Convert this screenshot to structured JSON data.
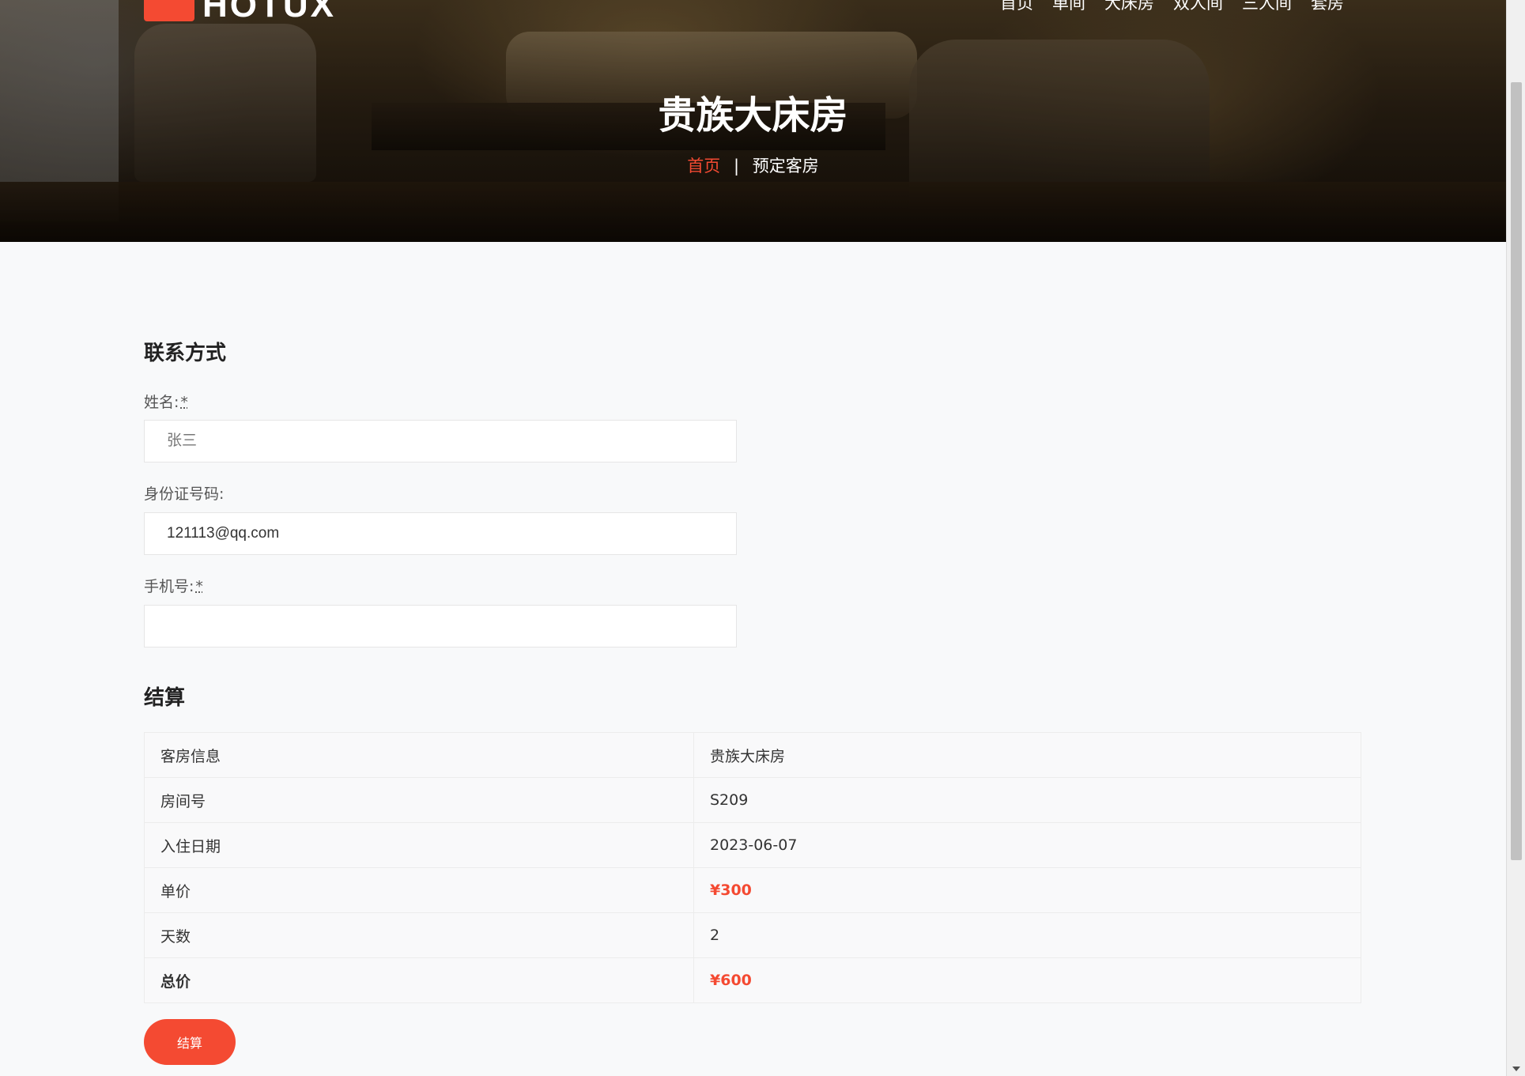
{
  "header": {
    "logo_text": "HOTUX",
    "nav": [
      "首页",
      "单间",
      "大床房",
      "双人间",
      "三人间",
      "套房"
    ]
  },
  "hero": {
    "title": "贵族大床房",
    "breadcrumb_home": "首页",
    "breadcrumb_sep": "|",
    "breadcrumb_current": "预定客房"
  },
  "contact": {
    "heading": "联系方式",
    "name_label": "姓名:",
    "name_required": "*",
    "name_placeholder": "张三",
    "id_label": "身份证号码:",
    "id_value": "121113@qq.com",
    "phone_label": "手机号:",
    "phone_required": "*",
    "phone_value": ""
  },
  "checkout": {
    "heading": "结算",
    "rows": [
      {
        "key": "客房信息",
        "value": "贵族大床房"
      },
      {
        "key": "房间号",
        "value": "S209"
      },
      {
        "key": "入住日期",
        "value": "2023-06-07"
      },
      {
        "key": "单价",
        "value": "¥300"
      },
      {
        "key": "天数",
        "value": "2"
      },
      {
        "key": "总价",
        "value": "¥600"
      }
    ],
    "submit_label": "结算"
  },
  "colors": {
    "accent": "#f44a32",
    "background": "#f8f9fa"
  }
}
